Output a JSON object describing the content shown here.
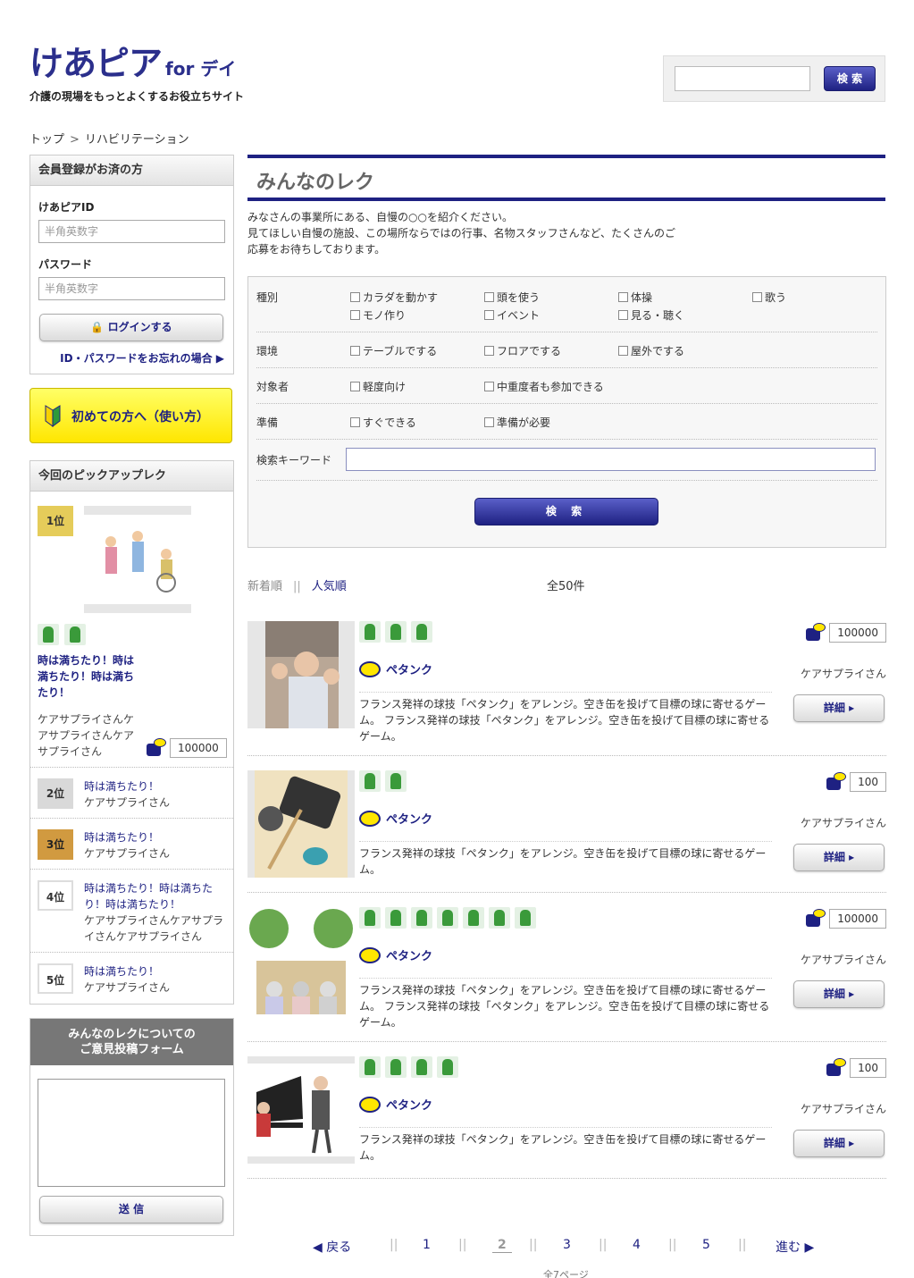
{
  "header": {
    "logo_main": "けあピア",
    "logo_for": "for デイ",
    "tagline": "介護の現場をもっとよくするお役立ちサイト",
    "search_button": "検 索"
  },
  "breadcrumb": {
    "home": "トップ",
    "sep": ">",
    "current": "リハビリテーション"
  },
  "login": {
    "heading": "会員登録がお済の方",
    "id_label": "けあピアID",
    "id_placeholder": "半角英数字",
    "password_label": "パスワード",
    "password_placeholder": "半角英数字",
    "login_button": "ログインする",
    "forgot_link": "ID・パスワードをお忘れの場合 ▶"
  },
  "beginner": {
    "label": "初めての方へ（使い方）"
  },
  "pickup": {
    "heading": "今回のピックアップレク",
    "first": {
      "rank": "1位",
      "title": "時は満ちたり！時は満ちたり！時は満ちたり！",
      "author": "ケアサプライさんケアサプライさんケアサプライさん",
      "likes": "100000"
    },
    "others": [
      {
        "rank": "2位",
        "title": "時は満ちたり！",
        "author": "ケアサプライさん"
      },
      {
        "rank": "3位",
        "title": "時は満ちたり！",
        "author": "ケアサプライさん"
      },
      {
        "rank": "4位",
        "title": "時は満ちたり！時は満ちたり！時は満ちたり！",
        "author": "ケアサプライさんケアサプライさんケアサプライさん"
      },
      {
        "rank": "5位",
        "title": "時は満ちたり！",
        "author": "ケアサプライさん"
      }
    ]
  },
  "opinion": {
    "heading_line1": "みんなのレクについての",
    "heading_line2": "ご意見投稿フォーム",
    "submit": "送 信"
  },
  "main": {
    "title": "みんなのレク",
    "intro": "みなさんの事業所にある、自慢の○○を紹介ください。\n見てほしい自慢の施設、この場所ならではの行事、名物スタッフさんなど、たくさんのご応募をお待ちしております。"
  },
  "filter": {
    "type_label": "種別",
    "type_options": [
      "カラダを動かす",
      "頭を使う",
      "体操",
      "歌う",
      "モノ作り",
      "イベント",
      "見る・聴く"
    ],
    "env_label": "環境",
    "env_options": [
      "テーブルでする",
      "フロアでする",
      "屋外でする"
    ],
    "target_label": "対象者",
    "target_options": [
      "軽度向け",
      "中重度者も参加できる"
    ],
    "prep_label": "準備",
    "prep_options": [
      "すぐできる",
      "準備が必要"
    ],
    "keyword_label": "検索キーワード",
    "search_button": "検 索"
  },
  "sort": {
    "new": "新着順",
    "sep": "||",
    "popular": "人気順",
    "total": "全50件"
  },
  "entries": [
    {
      "title": "ペタンク",
      "author": "ケアサプライさん",
      "likes": "100000",
      "detail": "詳細 ▸",
      "desc": "フランス発祥の球技「ペタンク」をアレンジ。空き缶を投げて目標の球に寄せるゲーム。 フランス発祥の球技「ペタンク」をアレンジ。空き缶を投げて目標の球に寄せるゲーム。"
    },
    {
      "title": "ペタンク",
      "author": "ケアサプライさん",
      "likes": "100",
      "detail": "詳細 ▸",
      "desc": "フランス発祥の球技「ペタンク」をアレンジ。空き缶を投げて目標の球に寄せるゲーム。"
    },
    {
      "title": "ペタンク",
      "author": "ケアサプライさん",
      "likes": "100000",
      "detail": "詳細 ▸",
      "desc": "フランス発祥の球技「ペタンク」をアレンジ。空き缶を投げて目標の球に寄せるゲーム。 フランス発祥の球技「ペタンク」をアレンジ。空き缶を投げて目標の球に寄せるゲーム。"
    },
    {
      "title": "ペタンク",
      "author": "ケアサプライさん",
      "likes": "100",
      "detail": "詳細 ▸",
      "desc": "フランス発祥の球技「ペタンク」をアレンジ。空き缶を投げて目標の球に寄せるゲーム。"
    }
  ],
  "pager": {
    "prev": "◀ 戻る",
    "next": "進む ▶",
    "sep": "||",
    "pages": [
      "1",
      "2",
      "3",
      "4",
      "5"
    ],
    "current": "2",
    "total": "全7ページ"
  },
  "colors": {
    "navy": "#1e2182",
    "yellow": "#ffe600",
    "green": "#3a9a3a"
  }
}
